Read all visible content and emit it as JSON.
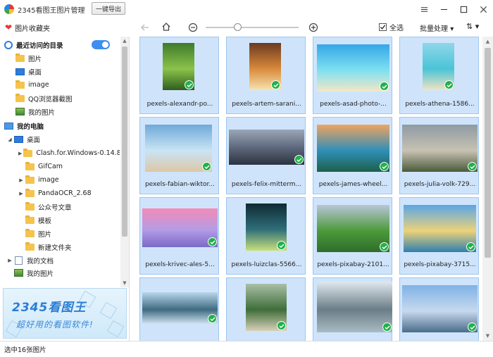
{
  "window": {
    "title": "2345看图王图片管理"
  },
  "toolbar": {
    "favorites_label": "图片收藏夹",
    "export_label": "一键导出",
    "select_all_label": "全选",
    "batch_label": "批量处理",
    "batch_arrow": "▾",
    "sort_glyph": "⇅ ▾",
    "zoom_level": 0.33
  },
  "sidebar": {
    "recent_label": "最近访问的目录",
    "recent_toggle_on": true,
    "recent_items": [
      "图片",
      "桌面",
      "image",
      "QQ浏览器截图",
      "我的图片"
    ],
    "computer_label": "我的电脑",
    "desktop_label": "桌面",
    "desktop_children": [
      "Clash.for.Windows-0.14.8",
      "GifCam",
      "image",
      "PandaOCR_2.68",
      "公众号文章",
      "模板",
      "图片",
      "新建文件夹"
    ],
    "documents_label": "我的文档",
    "mypictures_label": "我的图片"
  },
  "banner": {
    "brand": "2345看图王",
    "slogan": "超好用的看图软件!"
  },
  "images": [
    {
      "label": "pexels-alexandr-po...",
      "colors": [
        "#3f7a2b",
        "#8bc34a",
        "#2e5e1d"
      ]
    },
    {
      "label": "pexels-artem-sarani...",
      "colors": [
        "#6b3a1f",
        "#d98a3c",
        "#f6e4b0"
      ]
    },
    {
      "label": "pexels-asad-photo-...",
      "colors": [
        "#35a7e8",
        "#7fe0f0",
        "#f3e7c6"
      ]
    },
    {
      "label": "pexels-athena-1586...",
      "colors": [
        "#8fd6ea",
        "#4bc4d6",
        "#f0e3c3"
      ]
    },
    {
      "label": "pexels-fabian-wiktor...",
      "colors": [
        "#6fa9d8",
        "#c9e4f4",
        "#dcc8a6"
      ]
    },
    {
      "label": "pexels-felix-mitterm...",
      "colors": [
        "#9aa6b6",
        "#5a6478",
        "#2c3340"
      ]
    },
    {
      "label": "pexels-james-wheel...",
      "colors": [
        "#f0a460",
        "#2f8fb8",
        "#1d5f4a"
      ]
    },
    {
      "label": "pexels-julia-volk-729...",
      "colors": [
        "#8e9aa3",
        "#c7c2b2",
        "#4a5a3a"
      ]
    },
    {
      "label": "pexels-krivec-ales-5...",
      "colors": [
        "#f48ab6",
        "#b49ce6",
        "#7a6ac8"
      ]
    },
    {
      "label": "pexels-luizclas-5566...",
      "colors": [
        "#0f2a33",
        "#2f6e79",
        "#c8e07a"
      ]
    },
    {
      "label": "pexels-pixabay-2101...",
      "colors": [
        "#b8c6d8",
        "#4c9a3a",
        "#2f6d2a"
      ]
    },
    {
      "label": "pexels-pixabay-3715...",
      "colors": [
        "#5aa6e6",
        "#ecd27a",
        "#2f7fb0"
      ]
    },
    {
      "label": "",
      "colors": [
        "#b9d7ee",
        "#3f6b80",
        "#cfe3f0"
      ]
    },
    {
      "label": "",
      "colors": [
        "#a9bfa6",
        "#3f6e3a",
        "#d7d1b8"
      ]
    },
    {
      "label": "",
      "colors": [
        "#dfe8ee",
        "#6b7d86",
        "#a9bcc4"
      ]
    },
    {
      "label": "",
      "colors": [
        "#7fb2e6",
        "#c7d9ee",
        "#4a6c8a"
      ]
    }
  ],
  "status": {
    "text": "选中16张图片"
  }
}
